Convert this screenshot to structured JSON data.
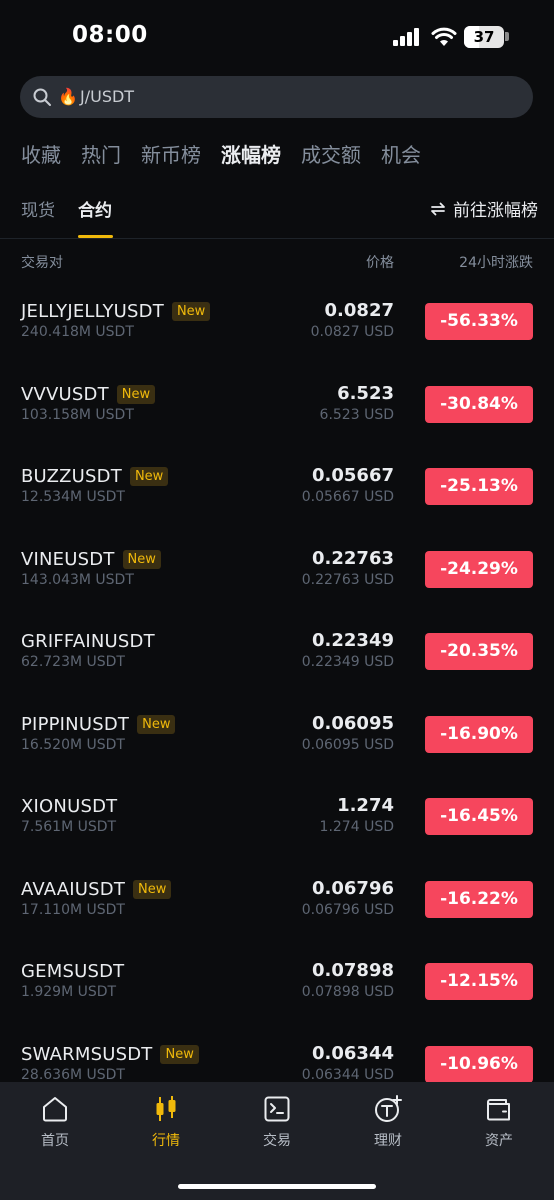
{
  "status_bar": {
    "time": "08:00",
    "battery": "37",
    "battery_level": 0.37
  },
  "search": {
    "fire_icon": "🔥",
    "text": "J/USDT"
  },
  "category_tabs": [
    {
      "label": "收藏"
    },
    {
      "label": "热门"
    },
    {
      "label": "新币榜"
    },
    {
      "label": "涨幅榜",
      "active": true
    },
    {
      "label": "成交额"
    },
    {
      "label": "机会"
    }
  ],
  "sub_tabs": [
    {
      "label": "现货"
    },
    {
      "label": "合约",
      "active": true
    }
  ],
  "goto_link": "前往涨幅榜",
  "columns": {
    "pair": "交易对",
    "price": "价格",
    "change": "24小时涨跌"
  },
  "rows": [
    {
      "symbol": "JELLYJELLYUSDT",
      "is_new": true,
      "badge": "New",
      "volume": "240.418M USDT",
      "price": "0.0827",
      "price_usd": "0.0827 USD",
      "change": "-56.33%"
    },
    {
      "symbol": "VVVUSDT",
      "is_new": true,
      "badge": "New",
      "volume": "103.158M USDT",
      "price": "6.523",
      "price_usd": "6.523 USD",
      "change": "-30.84%"
    },
    {
      "symbol": "BUZZUSDT",
      "is_new": true,
      "badge": "New",
      "volume": "12.534M USDT",
      "price": "0.05667",
      "price_usd": "0.05667 USD",
      "change": "-25.13%"
    },
    {
      "symbol": "VINEUSDT",
      "is_new": true,
      "badge": "New",
      "volume": "143.043M USDT",
      "price": "0.22763",
      "price_usd": "0.22763 USD",
      "change": "-24.29%"
    },
    {
      "symbol": "GRIFFAINUSDT",
      "is_new": false,
      "badge": "",
      "volume": "62.723M USDT",
      "price": "0.22349",
      "price_usd": "0.22349 USD",
      "change": "-20.35%"
    },
    {
      "symbol": "PIPPINUSDT",
      "is_new": true,
      "badge": "New",
      "volume": "16.520M USDT",
      "price": "0.06095",
      "price_usd": "0.06095 USD",
      "change": "-16.90%"
    },
    {
      "symbol": "XIONUSDT",
      "is_new": false,
      "badge": "",
      "volume": "7.561M USDT",
      "price": "1.274",
      "price_usd": "1.274 USD",
      "change": "-16.45%"
    },
    {
      "symbol": "AVAAIUSDT",
      "is_new": true,
      "badge": "New",
      "volume": "17.110M USDT",
      "price": "0.06796",
      "price_usd": "0.06796 USD",
      "change": "-16.22%"
    },
    {
      "symbol": "GEMSUSDT",
      "is_new": false,
      "badge": "",
      "volume": "1.929M USDT",
      "price": "0.07898",
      "price_usd": "0.07898 USD",
      "change": "-12.15%"
    },
    {
      "symbol": "SWARMSUSDT",
      "is_new": true,
      "badge": "New",
      "volume": "28.636M USDT",
      "price": "0.06344",
      "price_usd": "0.06344 USD",
      "change": "-10.96%"
    }
  ],
  "bottom_nav": [
    {
      "label": "首页",
      "icon": "home-icon"
    },
    {
      "label": "行情",
      "icon": "markets-icon",
      "active": true
    },
    {
      "label": "交易",
      "icon": "trade-icon"
    },
    {
      "label": "理财",
      "icon": "earn-icon"
    },
    {
      "label": "资产",
      "icon": "wallet-icon"
    }
  ],
  "colors": {
    "accent": "#f0b90b",
    "negative": "#f6465d",
    "background": "#0b0c0e",
    "nav_background": "#1e2026"
  }
}
